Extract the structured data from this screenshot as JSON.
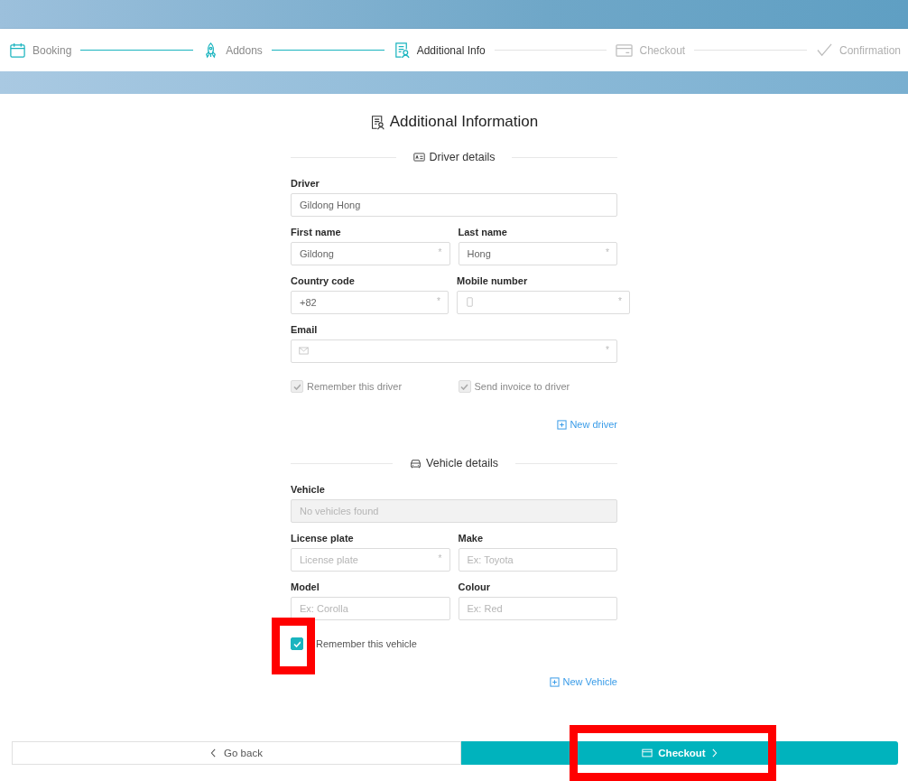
{
  "stepper": [
    {
      "label": "Booking",
      "completed": true,
      "selected": false
    },
    {
      "label": "Addons",
      "completed": true,
      "selected": false
    },
    {
      "label": "Additional Info",
      "completed": false,
      "selected": true
    },
    {
      "label": "Checkout",
      "completed": false,
      "selected": false
    },
    {
      "label": "Confirmation",
      "completed": false,
      "selected": false
    }
  ],
  "title": "Additional Information",
  "sections": [
    {
      "kind": "driver",
      "heading": "Driver details",
      "rows": [
        [
          {
            "label": "Driver",
            "value": "Gildong Hong"
          }
        ],
        [
          {
            "label": "First name",
            "value": "Gildong",
            "required_mark": "*"
          },
          {
            "label": "Last name",
            "value": "Hong",
            "required_mark": "*"
          }
        ],
        [
          {
            "label": "Country code",
            "value": "+82",
            "required_mark": "*"
          },
          {
            "label": "Mobile number",
            "kind": "phone",
            "required_mark": "*"
          }
        ],
        [
          {
            "label": "Email",
            "kind": "email",
            "required_mark": "*"
          }
        ]
      ],
      "checkboxes": [
        {
          "label": "Remember this driver",
          "checked": true,
          "disabled": true,
          "highlighted": false
        },
        {
          "label": "Send invoice to driver",
          "checked": true,
          "disabled": true,
          "highlighted": false
        }
      ],
      "link": "New driver"
    },
    {
      "kind": "vehicle",
      "heading": "Vehicle details",
      "rows": [
        [
          {
            "label": "Vehicle",
            "placeholder": "No vehicles found",
            "disabled": true
          }
        ],
        [
          {
            "label": "License plate",
            "placeholder": "License plate",
            "required_mark": "*"
          },
          {
            "label": "Make",
            "placeholder": "Ex: Toyota"
          }
        ],
        [
          {
            "label": "Model",
            "placeholder": "Ex: Corolla"
          },
          {
            "label": "Colour",
            "placeholder": "Ex: Red"
          }
        ]
      ],
      "checkboxes": [
        {
          "label": "Remember this vehicle",
          "checked": true,
          "disabled": false,
          "highlighted": true
        }
      ],
      "link": "New Vehicle"
    }
  ],
  "footer": {
    "back": "Go back",
    "next": "Checkout",
    "next_highlighted": true
  }
}
